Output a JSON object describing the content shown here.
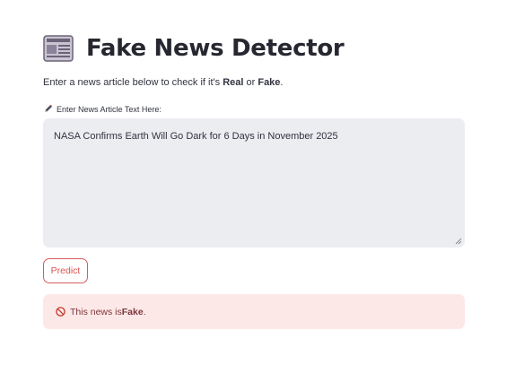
{
  "app": {
    "title": "Fake News Detector",
    "title_icon": "newspaper-icon"
  },
  "intro": {
    "prefix": "Enter a news article below to check if it's ",
    "real": "Real",
    "or": " or ",
    "fake": "Fake",
    "suffix": "."
  },
  "input": {
    "label_icon": "pencil-icon",
    "label": "Enter News Article Text Here:",
    "value": "NASA Confirms Earth Will Go Dark for 6 Days in November 2025"
  },
  "actions": {
    "predict_label": "Predict"
  },
  "result": {
    "icon": "no-entry-icon",
    "prefix": "This news is ",
    "verdict": "Fake",
    "suffix": "."
  },
  "colors": {
    "accent": "#d9534f",
    "error_bg": "#fde8e8",
    "error_text": "#7d353b",
    "input_bg": "#ebedf1"
  }
}
